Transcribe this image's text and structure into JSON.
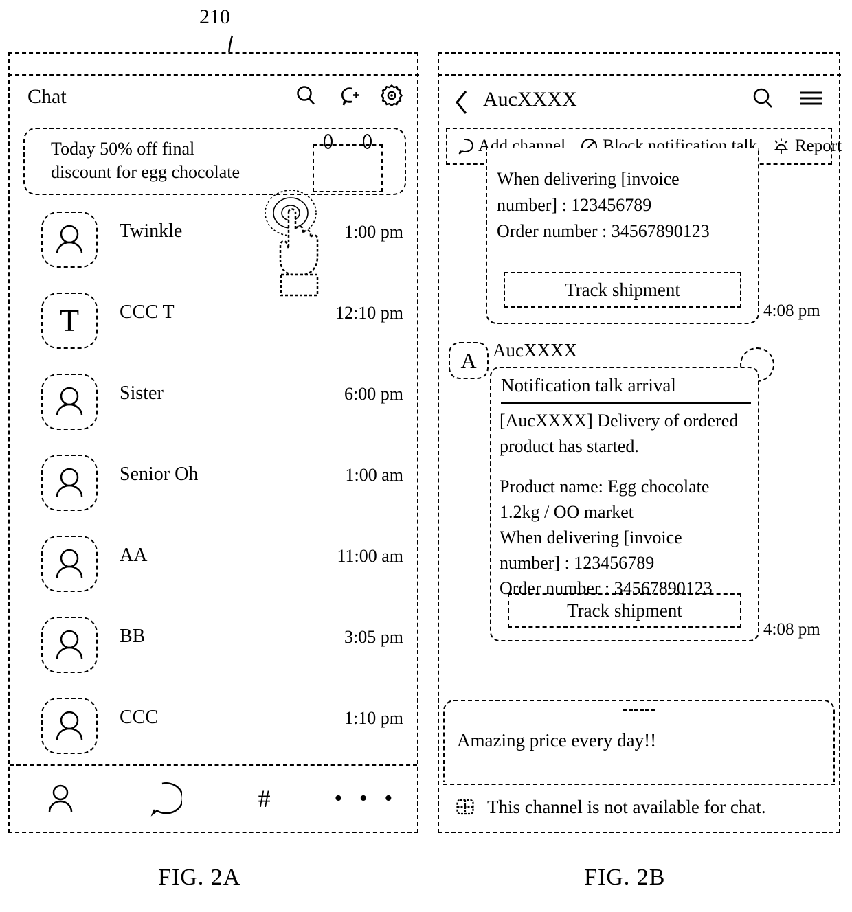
{
  "figures": {
    "a": {
      "caption": "FIG. 2A",
      "callout": "210",
      "header": {
        "title": "Chat",
        "icons": [
          "search-icon",
          "new-chat-icon",
          "settings-gear-icon"
        ]
      },
      "promo_banner": {
        "line1": "Today 50% off final",
        "line2": "discount for egg chocolate",
        "thumbnail": "image-placeholder-icon",
        "gesture": "tap-hand-icon"
      },
      "chat_list": [
        {
          "name": "Twinkle",
          "time": "1:00 pm",
          "avatar": "person-icon"
        },
        {
          "name": "CCC T",
          "time": "12:10 pm",
          "avatar": "T"
        },
        {
          "name": "Sister",
          "time": "6:00 pm",
          "avatar": "person-icon"
        },
        {
          "name": "Senior Oh",
          "time": "1:00 am",
          "avatar": "person-icon"
        },
        {
          "name": "AA",
          "time": "11:00 am",
          "avatar": "person-icon"
        },
        {
          "name": "BB",
          "time": "3:05 pm",
          "avatar": "person-icon"
        },
        {
          "name": "CCC",
          "time": "1:10 pm",
          "avatar": "person-icon"
        }
      ],
      "bottom_nav": [
        {
          "icon": "friends-person-icon",
          "label": ""
        },
        {
          "icon": "chat-bubble-icon",
          "label": ""
        },
        {
          "icon": "hashtag-icon",
          "label": "#"
        },
        {
          "icon": "more-dots-icon",
          "label": "• • •"
        }
      ]
    },
    "b": {
      "caption": "FIG. 2B",
      "header": {
        "back": "back-chevron-icon",
        "title": "AucXXXX",
        "icons": [
          "search-icon",
          "hamburger-menu-icon"
        ]
      },
      "action_bar": [
        {
          "icon": "speech-bubble-icon",
          "label": "Add channel"
        },
        {
          "icon": "block-circle-slash-icon",
          "label": "Block notification talk"
        },
        {
          "icon": "siren-alarm-icon",
          "label": "Report"
        }
      ],
      "message_1": {
        "line1": "When delivering [invoice",
        "line2": "number] :  123456789",
        "line3": "Order number : 34567890123",
        "button": "Track shipment",
        "time": "4:08 pm"
      },
      "message_2": {
        "avatar_letter": "A",
        "sender": "AucXXXX",
        "title": "Notification talk arrival",
        "line1": "[AucXXXX] Delivery of ordered",
        "line2": "product has started.",
        "line3": "  Product name: Egg chocolate",
        "line4": "1.2kg / OO market",
        "line5": "  When delivering [invoice",
        "line6": "number] : 123456789",
        "line7": "  Order number : 34567890123",
        "button": "Track shipment",
        "time": "4:08 pm",
        "badge": "unread-circle-icon"
      },
      "promo_sheet": {
        "handle": "drag-handle-icon",
        "text": "Amazing price every day!!"
      },
      "chat_disabled": {
        "icon": "grid-keyboard-icon",
        "text": "This channel is not available for chat."
      }
    }
  }
}
